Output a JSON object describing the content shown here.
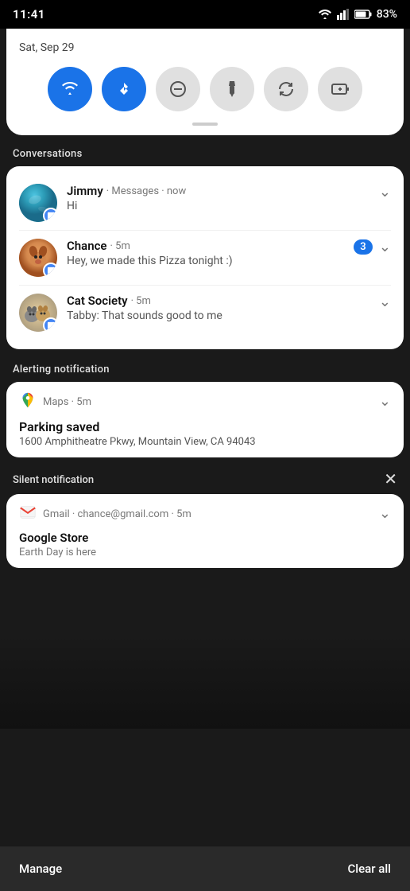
{
  "status_bar": {
    "time": "11:41",
    "battery": "83%",
    "wifi_icon": "wifi",
    "signal_icon": "signal",
    "battery_icon": "battery"
  },
  "quick_settings": {
    "date": "Sat, Sep 29",
    "toggles": [
      {
        "id": "wifi",
        "icon": "wifi",
        "active": true
      },
      {
        "id": "bluetooth",
        "icon": "bluetooth",
        "active": true
      },
      {
        "id": "dnd",
        "icon": "minus-circle",
        "active": false
      },
      {
        "id": "flashlight",
        "icon": "flashlight",
        "active": false
      },
      {
        "id": "rotate",
        "icon": "rotate",
        "active": false
      },
      {
        "id": "battery-saver",
        "icon": "battery-plus",
        "active": false
      }
    ]
  },
  "sections": {
    "conversations_label": "Conversations",
    "alerting_label": "Alerting notification",
    "silent_label": "Silent notification"
  },
  "conversations": [
    {
      "name": "Jimmy",
      "app": "Messages",
      "time": "now",
      "preview": "Hi",
      "has_badge": false,
      "badge_count": null
    },
    {
      "name": "Chance",
      "app": "5m",
      "time": "",
      "preview": "Hey, we made this Pizza tonight :)",
      "has_badge": true,
      "badge_count": "3"
    },
    {
      "name": "Cat Society",
      "app": "5m",
      "time": "",
      "preview": "Tabby: That sounds good to me",
      "has_badge": false,
      "badge_count": null
    }
  ],
  "alerting_notification": {
    "app_name": "Maps",
    "time": "5m",
    "title": "Parking saved",
    "body": "1600 Amphitheatre Pkwy, Mountain View, CA 94043"
  },
  "silent_notification": {
    "app_name": "Gmail",
    "sender": "chance@gmail.com",
    "time": "5m",
    "title": "Google Store",
    "body": "Earth Day is here"
  },
  "bottom_bar": {
    "manage_label": "Manage",
    "clear_all_label": "Clear all"
  }
}
